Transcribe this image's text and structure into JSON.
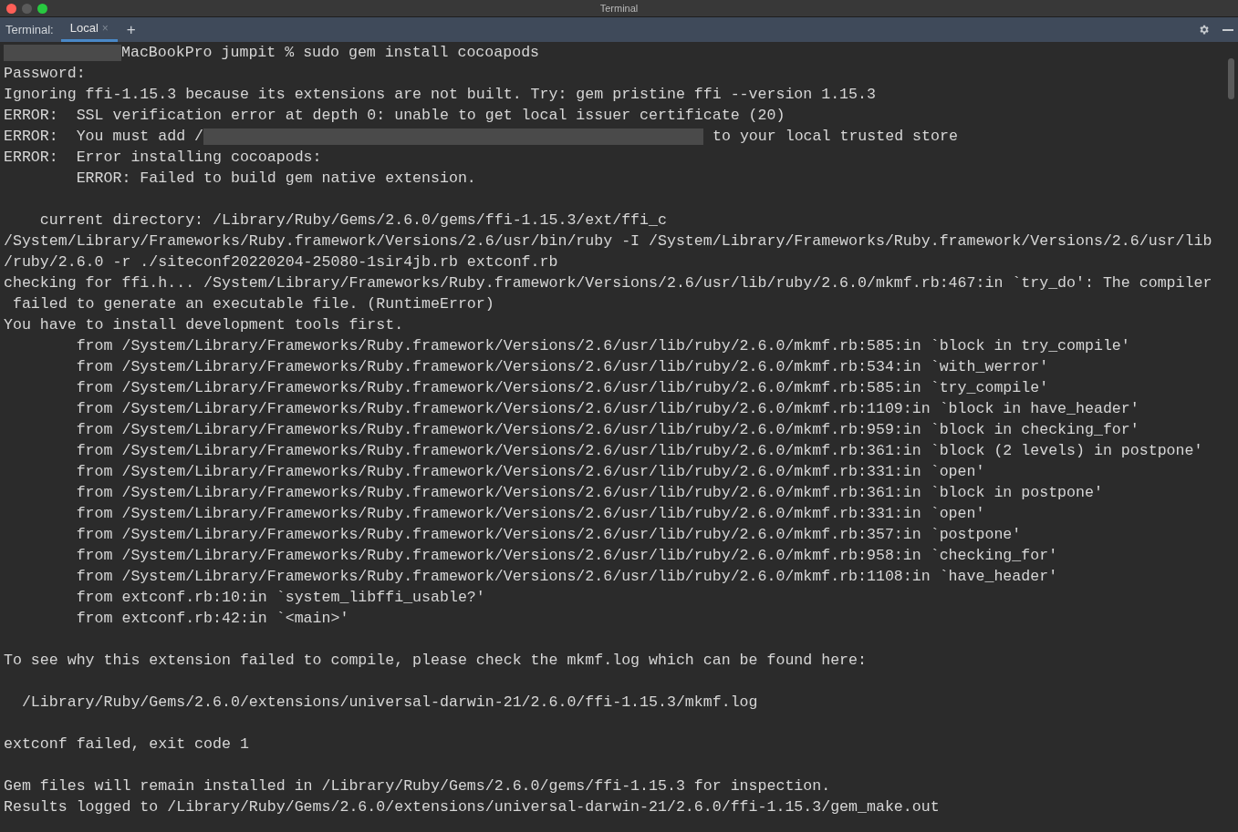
{
  "window": {
    "title": "Terminal"
  },
  "tool_window": {
    "label": "Terminal:",
    "tabs": [
      {
        "label": "Local",
        "selected": true,
        "close": "×"
      }
    ],
    "add": "+"
  },
  "lines": [
    {
      "kind": "mixed",
      "segments": [
        {
          "kind": "redacted-name"
        },
        {
          "kind": "text",
          "text": "MacBookPro jumpit % sudo gem install cocoapods"
        }
      ]
    },
    {
      "kind": "text",
      "text": "Password:"
    },
    {
      "kind": "text",
      "text": "Ignoring ffi-1.15.3 because its extensions are not built. Try: gem pristine ffi --version 1.15.3"
    },
    {
      "kind": "text",
      "text": "ERROR:  SSL verification error at depth 0: unable to get local issuer certificate (20)"
    },
    {
      "kind": "mixed",
      "segments": [
        {
          "kind": "text",
          "text": "ERROR:  You must add /"
        },
        {
          "kind": "redacted-path"
        },
        {
          "kind": "text",
          "text": " to your local trusted store"
        }
      ]
    },
    {
      "kind": "text",
      "text": "ERROR:  Error installing cocoapods:"
    },
    {
      "kind": "text",
      "text": "        ERROR: Failed to build gem native extension."
    },
    {
      "kind": "blank"
    },
    {
      "kind": "text",
      "text": "    current directory: /Library/Ruby/Gems/2.6.0/gems/ffi-1.15.3/ext/ffi_c"
    },
    {
      "kind": "text",
      "text": "/System/Library/Frameworks/Ruby.framework/Versions/2.6/usr/bin/ruby -I /System/Library/Frameworks/Ruby.framework/Versions/2.6/usr/lib"
    },
    {
      "kind": "text",
      "text": "/ruby/2.6.0 -r ./siteconf20220204-25080-1sir4jb.rb extconf.rb"
    },
    {
      "kind": "text",
      "text": "checking for ffi.h... /System/Library/Frameworks/Ruby.framework/Versions/2.6/usr/lib/ruby/2.6.0/mkmf.rb:467:in `try_do': The compiler"
    },
    {
      "kind": "text",
      "text": " failed to generate an executable file. (RuntimeError)"
    },
    {
      "kind": "text",
      "text": "You have to install development tools first."
    },
    {
      "kind": "text",
      "text": "        from /System/Library/Frameworks/Ruby.framework/Versions/2.6/usr/lib/ruby/2.6.0/mkmf.rb:585:in `block in try_compile'"
    },
    {
      "kind": "text",
      "text": "        from /System/Library/Frameworks/Ruby.framework/Versions/2.6/usr/lib/ruby/2.6.0/mkmf.rb:534:in `with_werror'"
    },
    {
      "kind": "text",
      "text": "        from /System/Library/Frameworks/Ruby.framework/Versions/2.6/usr/lib/ruby/2.6.0/mkmf.rb:585:in `try_compile'"
    },
    {
      "kind": "text",
      "text": "        from /System/Library/Frameworks/Ruby.framework/Versions/2.6/usr/lib/ruby/2.6.0/mkmf.rb:1109:in `block in have_header'"
    },
    {
      "kind": "text",
      "text": "        from /System/Library/Frameworks/Ruby.framework/Versions/2.6/usr/lib/ruby/2.6.0/mkmf.rb:959:in `block in checking_for'"
    },
    {
      "kind": "text",
      "text": "        from /System/Library/Frameworks/Ruby.framework/Versions/2.6/usr/lib/ruby/2.6.0/mkmf.rb:361:in `block (2 levels) in postpone'"
    },
    {
      "kind": "text",
      "text": "        from /System/Library/Frameworks/Ruby.framework/Versions/2.6/usr/lib/ruby/2.6.0/mkmf.rb:331:in `open'"
    },
    {
      "kind": "text",
      "text": "        from /System/Library/Frameworks/Ruby.framework/Versions/2.6/usr/lib/ruby/2.6.0/mkmf.rb:361:in `block in postpone'"
    },
    {
      "kind": "text",
      "text": "        from /System/Library/Frameworks/Ruby.framework/Versions/2.6/usr/lib/ruby/2.6.0/mkmf.rb:331:in `open'"
    },
    {
      "kind": "text",
      "text": "        from /System/Library/Frameworks/Ruby.framework/Versions/2.6/usr/lib/ruby/2.6.0/mkmf.rb:357:in `postpone'"
    },
    {
      "kind": "text",
      "text": "        from /System/Library/Frameworks/Ruby.framework/Versions/2.6/usr/lib/ruby/2.6.0/mkmf.rb:958:in `checking_for'"
    },
    {
      "kind": "text",
      "text": "        from /System/Library/Frameworks/Ruby.framework/Versions/2.6/usr/lib/ruby/2.6.0/mkmf.rb:1108:in `have_header'"
    },
    {
      "kind": "text",
      "text": "        from extconf.rb:10:in `system_libffi_usable?'"
    },
    {
      "kind": "text",
      "text": "        from extconf.rb:42:in `<main>'"
    },
    {
      "kind": "blank"
    },
    {
      "kind": "text",
      "text": "To see why this extension failed to compile, please check the mkmf.log which can be found here:"
    },
    {
      "kind": "blank"
    },
    {
      "kind": "text",
      "text": "  /Library/Ruby/Gems/2.6.0/extensions/universal-darwin-21/2.6.0/ffi-1.15.3/mkmf.log"
    },
    {
      "kind": "blank"
    },
    {
      "kind": "text",
      "text": "extconf failed, exit code 1"
    },
    {
      "kind": "blank"
    },
    {
      "kind": "text",
      "text": "Gem files will remain installed in /Library/Ruby/Gems/2.6.0/gems/ffi-1.15.3 for inspection."
    },
    {
      "kind": "text",
      "text": "Results logged to /Library/Ruby/Gems/2.6.0/extensions/universal-darwin-21/2.6.0/ffi-1.15.3/gem_make.out"
    }
  ]
}
